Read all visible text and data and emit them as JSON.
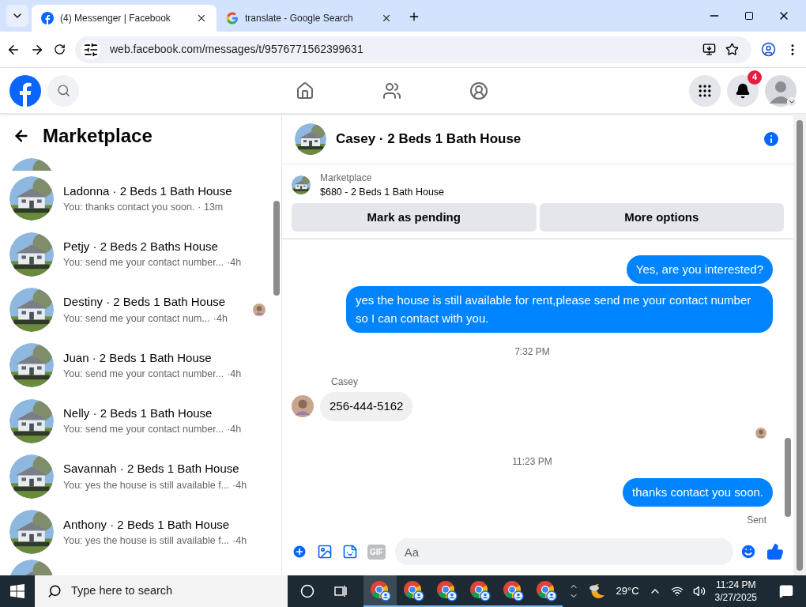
{
  "browser": {
    "tabs": [
      {
        "kind": "facebook",
        "title": "(4) Messenger | Facebook",
        "selected": true
      },
      {
        "kind": "google",
        "title": "translate - Google Search",
        "selected": false
      }
    ],
    "url": "web.facebook.com/messages/t/9576771562399631"
  },
  "header": {
    "notification_count": "4"
  },
  "sidebar": {
    "title": "Marketplace",
    "conversations": [
      {
        "name": "Ladonna · 2 Beds 1 Bath House",
        "preview": "You: thanks contact you soon.",
        "time": "· 13m",
        "seen": false
      },
      {
        "name": "Petjy · 2 Beds 2 Baths House",
        "preview": "You: send me your contact number...",
        "time": "·4h",
        "seen": false
      },
      {
        "name": "Destiny · 2 Beds 1 Bath House",
        "preview": "You: send me your contact num...",
        "time": "·4h",
        "seen": true
      },
      {
        "name": "Juan · 2 Beds 1 Bath House",
        "preview": "You: send me your contact number...",
        "time": "·4h",
        "seen": false
      },
      {
        "name": "Nelly · 2 Beds 1 Bath House",
        "preview": "You: send me your contact number...",
        "time": "·4h",
        "seen": false
      },
      {
        "name": "Savannah · 2 Beds 1 Bath House",
        "preview": "You: yes the house is still available f...",
        "time": "·4h",
        "seen": false
      },
      {
        "name": "Anthony · 2 Beds 1 Bath House",
        "preview": "You: yes the house is still available f...",
        "time": "·4h",
        "seen": false
      }
    ]
  },
  "chat": {
    "title": "Casey · 2 Beds 1 Bath House",
    "listing": {
      "label": "Marketplace",
      "title": "$680 - 2 Beds 1 Bath House"
    },
    "buttons": [
      "Mark as pending",
      "More options"
    ],
    "messages": [
      {
        "kind": "outgoing",
        "text": "Yes, are you interested?"
      },
      {
        "kind": "outgoing",
        "text": "yes the house is still available for rent,please send me your contact number so I can contact with you."
      },
      {
        "kind": "time",
        "text": "7:32 PM"
      },
      {
        "kind": "incoming",
        "sender": "Casey",
        "text": "256-444-5162"
      },
      {
        "kind": "seen"
      },
      {
        "kind": "time",
        "text": "11:23 PM"
      },
      {
        "kind": "outgoing",
        "text": "thanks contact you soon.",
        "status": "Sent"
      }
    ],
    "composer": {
      "gif_label": "GIF",
      "placeholder": "Aa"
    }
  },
  "taskbar": {
    "search_placeholder": "Type here to search",
    "temperature": "29°C",
    "time": "11:24 PM",
    "date": "3/27/2025"
  }
}
